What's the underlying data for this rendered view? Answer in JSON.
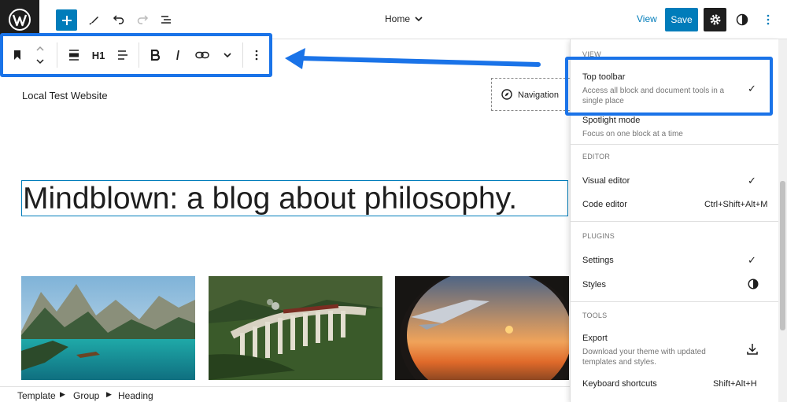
{
  "header": {
    "document_title": "Home",
    "view_label": "View",
    "save_label": "Save"
  },
  "block_toolbar": {
    "heading_level": "H1"
  },
  "canvas": {
    "site_title": "Local Test Website",
    "navigation_label": "Navigation",
    "heading_text": "Mindblown: a blog about philosophy.",
    "images": [
      "mountain-lake-photo",
      "viaduct-train-photo",
      "airplane-window-sunset-photo"
    ]
  },
  "breadcrumbs": [
    "Template",
    "Group",
    "Heading"
  ],
  "options_menu": {
    "view": {
      "title": "VIEW",
      "top_toolbar": {
        "label": "Top toolbar",
        "desc": "Access all block and document tools in a single place",
        "checked": true
      },
      "spotlight": {
        "label": "Spotlight mode",
        "desc": "Focus on one block at a time"
      }
    },
    "editor": {
      "title": "EDITOR",
      "visual": {
        "label": "Visual editor",
        "checked": true
      },
      "code": {
        "label": "Code editor",
        "shortcut": "Ctrl+Shift+Alt+M"
      }
    },
    "plugins": {
      "title": "PLUGINS",
      "settings": {
        "label": "Settings",
        "checked": true
      },
      "styles": {
        "label": "Styles"
      }
    },
    "tools": {
      "title": "TOOLS",
      "export": {
        "label": "Export",
        "desc": "Download your theme with updated templates and styles."
      },
      "shortcuts": {
        "label": "Keyboard shortcuts",
        "shortcut": "Shift+Alt+H"
      }
    }
  },
  "colors": {
    "accent": "#007cba",
    "annotation": "#1a73e8",
    "dark": "#1e1e1e"
  }
}
